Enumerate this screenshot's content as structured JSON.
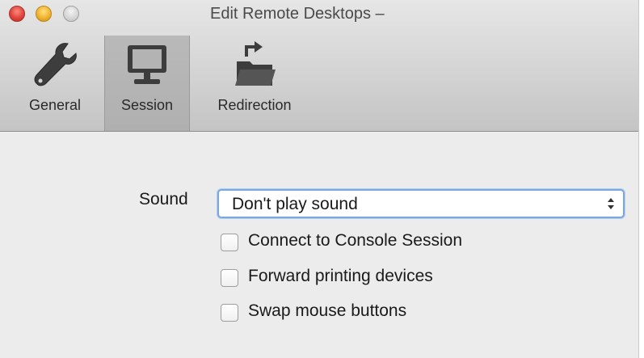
{
  "window": {
    "title": "Edit Remote Desktops –"
  },
  "toolbar": {
    "tabs": [
      {
        "label": "General",
        "icon": "wrench-icon",
        "selected": false
      },
      {
        "label": "Session",
        "icon": "monitor-icon",
        "selected": true
      },
      {
        "label": "Redirection",
        "icon": "folder-redirect-icon",
        "selected": false
      }
    ]
  },
  "session": {
    "sound_label": "Sound",
    "sound_select": {
      "value": "Don't play sound"
    },
    "options": [
      {
        "label": "Connect to Console Session",
        "checked": false
      },
      {
        "label": "Forward printing devices",
        "checked": false
      },
      {
        "label": "Swap mouse buttons",
        "checked": false
      }
    ]
  },
  "colors": {
    "focus_ring": "#7ba8e0",
    "close": "#e0443b",
    "minimize": "#f1b233",
    "zoom": "#d4d4d4"
  }
}
